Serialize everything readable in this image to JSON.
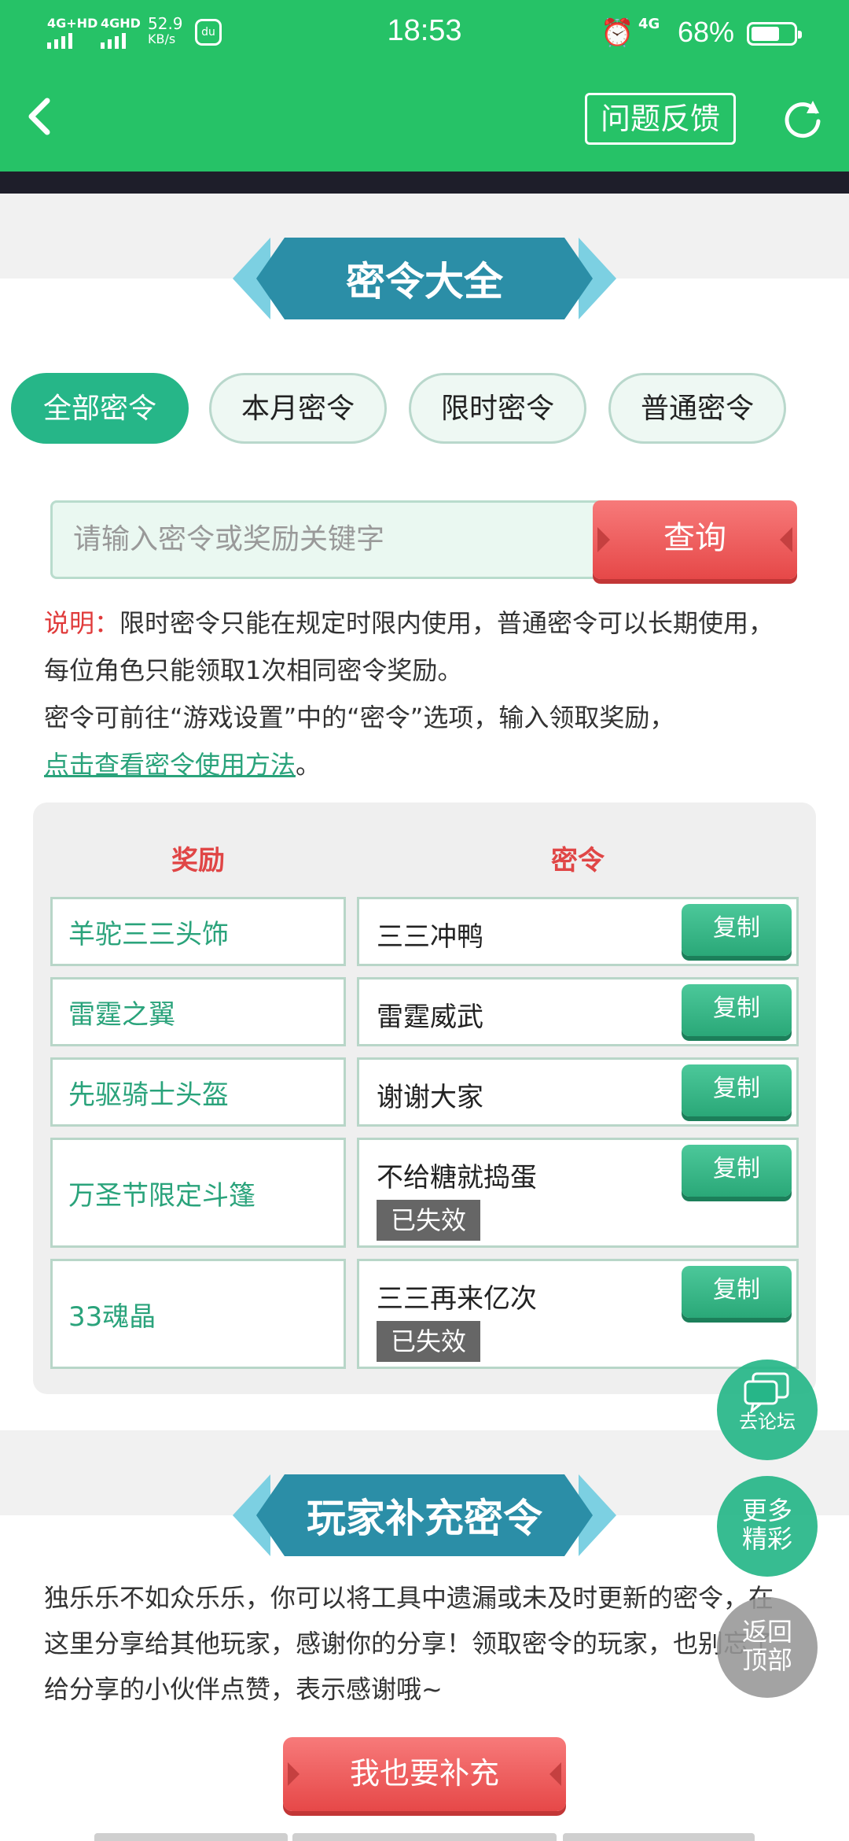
{
  "status_bar": {
    "signal_1": "4G+HD",
    "signal_2": "4GHD",
    "net_speed": "52.9",
    "net_unit": "KB/s",
    "time": "18:53",
    "alarm_icon": "alarm-icon",
    "net_type": "4G",
    "battery": "68%",
    "battery_level": 0.68
  },
  "header": {
    "back_icon": "back-chevron-icon",
    "feedback_label": "问题反馈",
    "refresh_icon": "refresh-icon"
  },
  "section1": {
    "title": "密令大全",
    "tabs": [
      {
        "label": "全部密令",
        "active": true
      },
      {
        "label": "本月密令",
        "active": false
      },
      {
        "label": "限时密令",
        "active": false
      },
      {
        "label": "普通密令",
        "active": false
      }
    ],
    "search": {
      "placeholder": "请输入密令或奖励关键字",
      "button_label": "查询"
    },
    "desc": {
      "label": "说明：",
      "text1": "限时密令只能在规定时限内使用，普通密令可以长期使用，每位角色只能领取1次相同密令奖励。",
      "text2": "密令可前往“游戏设置”中的“密令”选项，输入领取奖励，",
      "link": "点击查看密令使用方法",
      "tail": "。"
    },
    "table": {
      "header_reward": "奖励",
      "header_code": "密令",
      "copy_label": "复制",
      "expired_label": "已失效",
      "rows": [
        {
          "reward": "羊驼三三头饰",
          "code": "三三冲鸭",
          "expired": false
        },
        {
          "reward": "雷霆之翼",
          "code": "雷霆威武",
          "expired": false
        },
        {
          "reward": "先驱骑士头盔",
          "code": "谢谢大家",
          "expired": false
        },
        {
          "reward": "万圣节限定斗篷",
          "code": "不给糖就捣蛋",
          "expired": true
        },
        {
          "reward": "33魂晶",
          "code": "三三再来亿次",
          "expired": true
        }
      ]
    }
  },
  "floating": {
    "forum_icon": "chat-bubbles-icon",
    "forum_label": "去论坛",
    "more_line1": "更多",
    "more_line2": "精彩",
    "top_line1": "返回",
    "top_line2": "顶部"
  },
  "section2": {
    "title": "玩家补充密令",
    "text": "独乐乐不如众乐乐，你可以将工具中遗漏或未及时更新的密令，在这里分享给其他玩家，感谢你的分享！领取密令的玩家，也别忘了给分享的小伙伴点赞，表示感谢哦~",
    "button_label": "我也要补充"
  },
  "colors": {
    "header_green": "#26c267",
    "tab_active": "#26b688",
    "banner_blue": "#2b8ea7",
    "accent_red": "#e64848",
    "reward_green": "#2aa37b"
  }
}
